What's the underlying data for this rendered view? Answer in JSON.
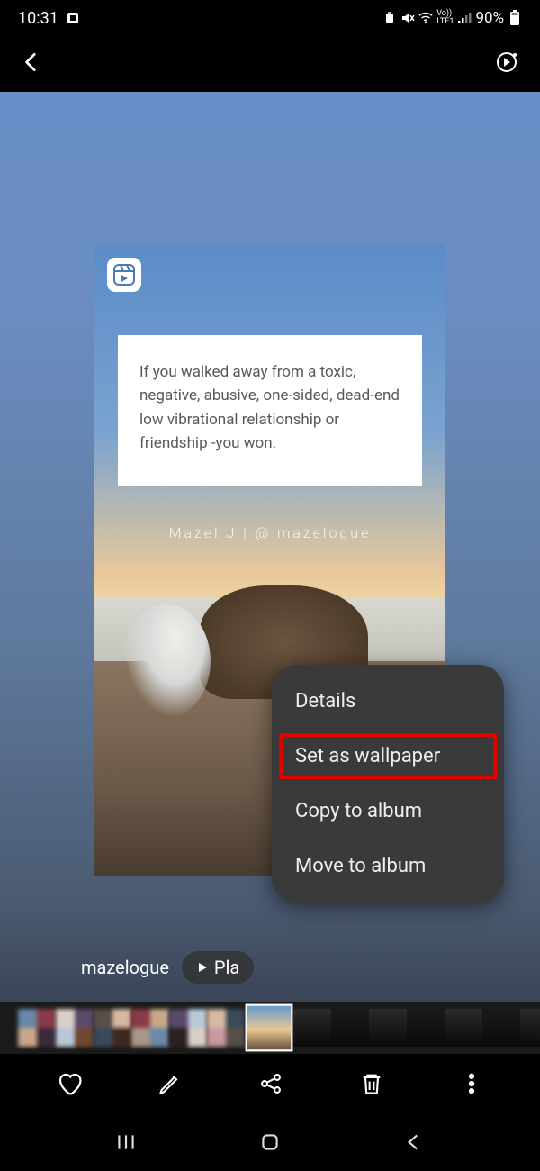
{
  "status": {
    "time": "10:31",
    "battery": "90%",
    "network_label": "Vo))\nLTE1"
  },
  "photo": {
    "quote": "If you walked away from a toxic, negative, abusive, one-sided, dead-end low vibrational relationship or friendship -you won.",
    "watermark": "Mazel J | @ mazelogue",
    "source_tag": "mazelogue",
    "play_label": "Pla"
  },
  "menu": {
    "items": [
      {
        "label": "Details",
        "highlighted": false
      },
      {
        "label": "Set as wallpaper",
        "highlighted": true
      },
      {
        "label": "Copy to album",
        "highlighted": false
      },
      {
        "label": "Move to album",
        "highlighted": false
      }
    ]
  },
  "thumb_colors": [
    "#8a3a4a",
    "#c89aa0",
    "#5a4a6a",
    "#3a2a3a",
    "#d8b8a0",
    "#704830",
    "#c8a888",
    "#402820",
    "#b8c8d8",
    "#6a88a8",
    "#3a4a5a",
    "#d8d0c8",
    "#a89888",
    "#585048",
    "#2a2220"
  ]
}
